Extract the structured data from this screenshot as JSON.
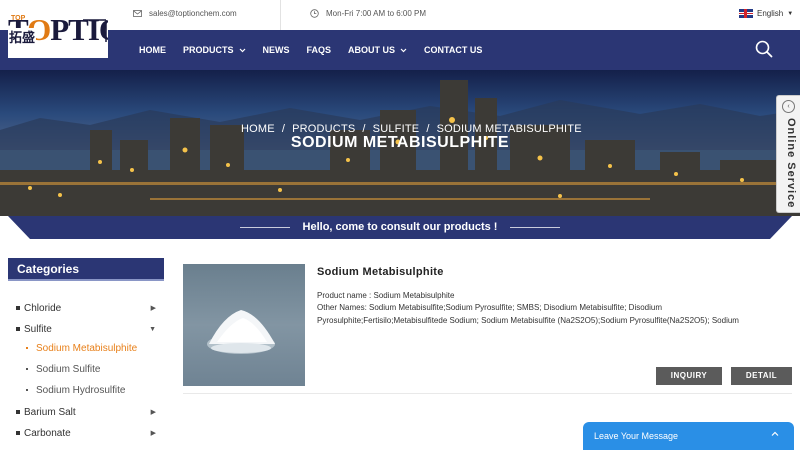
{
  "header": {
    "logo": {
      "text_top": "TOPTION",
      "text_cn": "拓盛"
    },
    "email": "sales@toptionchem.com",
    "hours": "Mon-Fri 7:00 AM to 6:00 PM",
    "language": "English"
  },
  "nav": {
    "items": [
      {
        "label": "HOME",
        "dropdown": false
      },
      {
        "label": "PRODUCTS",
        "dropdown": true
      },
      {
        "label": "NEWS",
        "dropdown": false
      },
      {
        "label": "FAQS",
        "dropdown": false
      },
      {
        "label": "ABOUT US",
        "dropdown": true
      },
      {
        "label": "CONTACT US",
        "dropdown": false
      }
    ]
  },
  "banner": {
    "breadcrumb": [
      "HOME",
      "/",
      "PRODUCTS",
      "/",
      "SULFITE",
      "/",
      "SODIUM METABISULPHITE"
    ],
    "title": "SODIUM METABISULPHITE"
  },
  "strip": {
    "text": "Hello, come to consult our products !"
  },
  "online_service": {
    "label": "Online Service"
  },
  "sidebar": {
    "title": "Categories",
    "categories": [
      {
        "label": "Chloride",
        "arrow": "▶"
      },
      {
        "label": "Sulfite",
        "arrow": "▼"
      },
      {
        "label": "Barium Salt",
        "arrow": "▶"
      },
      {
        "label": "Carbonate",
        "arrow": "▶"
      }
    ],
    "subcategories": [
      {
        "label": "Sodium Metabisulphite",
        "active": true
      },
      {
        "label": "Sodium Sulfite",
        "active": false
      },
      {
        "label": "Sodium Hydrosulfite",
        "active": false
      }
    ]
  },
  "product": {
    "name": "Sodium Metabisulphite",
    "product_name_label": "Product name :",
    "product_name_value": "Sodium Metabisulphite",
    "other_names_line1": "Other Names: Sodium Metabisulfite;Sodium Pyrosulfite; SMBS; Disodium Metabisulfite; Disodium",
    "other_names_line2": "Pyrosulphite;Fertisilo;Metabisulfitede Sodium; Sodium Metabisulfite (Na2S2O5);Sodium Pyrosulfite(Na2S2O5); Sodium",
    "inquiry_label": "INQUIRY",
    "detail_label": "DETAIL"
  },
  "leave_message": {
    "label": "Leave Your Message"
  },
  "colors": {
    "navy": "#2b3674",
    "accent_orange": "#e8801a",
    "chat_blue": "#2a8fe6",
    "button_gray": "#5b5b5b"
  }
}
